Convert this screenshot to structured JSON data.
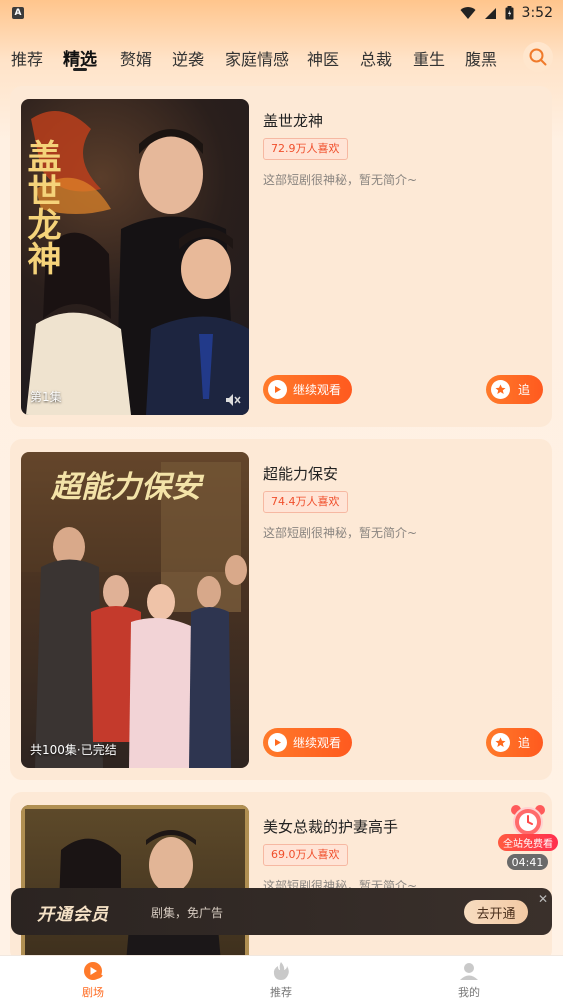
{
  "status_bar": {
    "time": "3:52",
    "app_badge": "A"
  },
  "tabs": [
    {
      "label": "推荐"
    },
    {
      "label": "精选"
    },
    {
      "label": "赘婿"
    },
    {
      "label": "逆袭"
    },
    {
      "label": "家庭情感"
    },
    {
      "label": "神医"
    },
    {
      "label": "总裁"
    },
    {
      "label": "重生"
    },
    {
      "label": "腹黑"
    }
  ],
  "active_tab": "精选",
  "dramas": [
    {
      "title": "盖世龙神",
      "likes": "72.9万人喜欢",
      "description": "这部短剧很神秘，暂无简介~",
      "poster_caption": "第1集",
      "poster_title": "盖世龙神",
      "continue_label": "继续观看",
      "follow_label": "追"
    },
    {
      "title": "超能力保安",
      "likes": "74.4万人喜欢",
      "description": "这部短剧很神秘，暂无简介~",
      "poster_caption": "共100集·已完结",
      "poster_title": "超能力保安",
      "continue_label": "继续观看",
      "follow_label": "追"
    },
    {
      "title": "美女总裁的护妻高手",
      "likes": "69.0万人喜欢",
      "description": "这部短剧很神秘，暂无简介~"
    }
  ],
  "promo": {
    "label": "全站免费看",
    "timer": "04:41"
  },
  "vip_banner": {
    "logo": "开通会员",
    "text": "剧集，免广告",
    "button": "去开通"
  },
  "bottom_nav": [
    {
      "label": "剧场",
      "icon": "theater-icon"
    },
    {
      "label": "推荐",
      "icon": "flame-icon"
    },
    {
      "label": "我的",
      "icon": "profile-icon"
    }
  ],
  "colors": {
    "accent": "#ff6a1f",
    "tag_text": "#f04f2c",
    "card_bg": "#fde9d6"
  }
}
